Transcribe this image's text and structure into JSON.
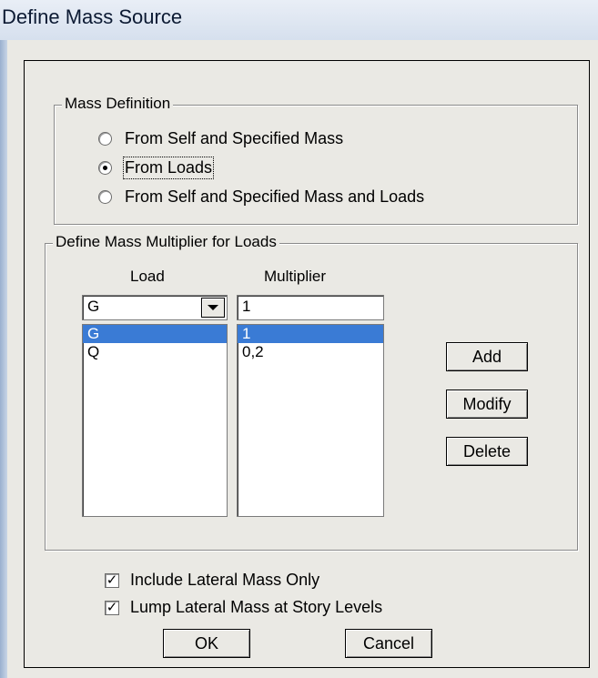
{
  "window": {
    "title": "Define Mass Source"
  },
  "mass_definition": {
    "label": "Mass Definition",
    "options": [
      {
        "label": "From Self and Specified Mass",
        "selected": false
      },
      {
        "label": "From Loads",
        "selected": true
      },
      {
        "label": "From Self and Specified Mass and Loads",
        "selected": false
      }
    ]
  },
  "multiplier": {
    "label": "Define Mass Multiplier for Loads",
    "load_header": "Load",
    "multiplier_header": "Multiplier",
    "load_value": "G",
    "multiplier_value": "1",
    "load_list": [
      "G",
      "Q"
    ],
    "multiplier_list": [
      "1",
      "0,2"
    ],
    "selected_index": 0,
    "add_label": "Add",
    "modify_label": "Modify",
    "delete_label": "Delete"
  },
  "options": {
    "include_lateral": {
      "label": "Include Lateral Mass Only",
      "checked": true
    },
    "lump_lateral": {
      "label": "Lump Lateral Mass at Story Levels",
      "checked": true
    }
  },
  "buttons": {
    "ok": "OK",
    "cancel": "Cancel"
  },
  "colors": {
    "selection": "#3a7bd5",
    "dialog_bg": "#eae9e4",
    "title_text": "#0c1a33"
  },
  "icons": {
    "checkmark": "check-icon",
    "dropdown": "chevron-down-icon"
  }
}
